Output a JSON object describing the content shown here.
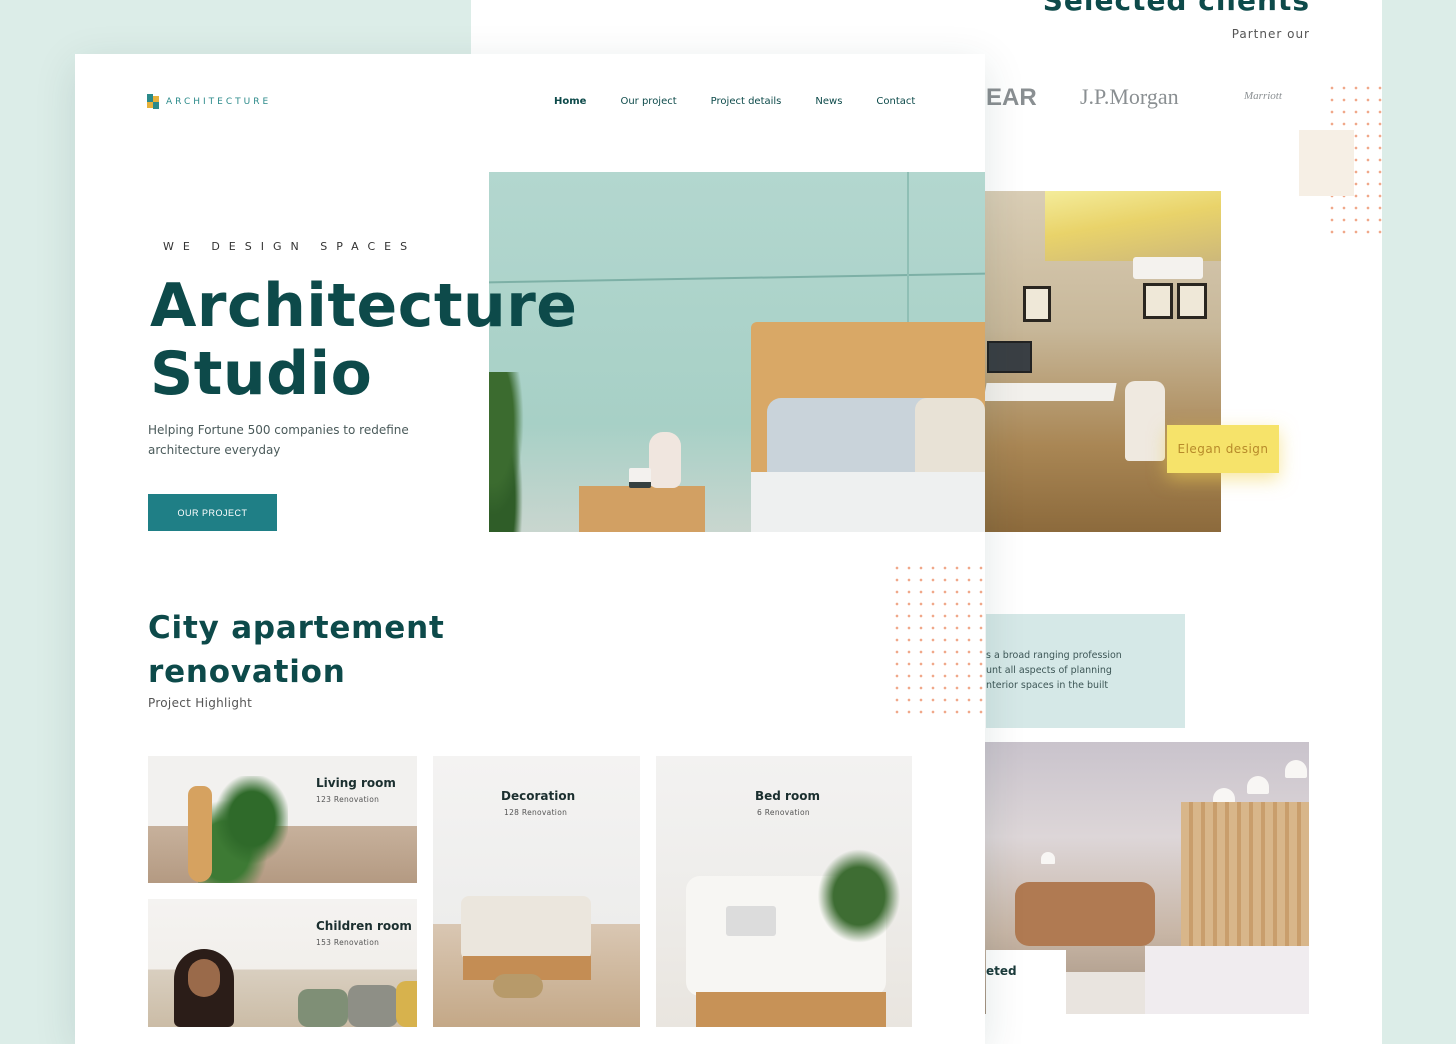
{
  "back_page": {
    "title": "Selected clients",
    "subtitle": "Partner our",
    "logos": [
      "EAR",
      "J.P.Morgan",
      "Marriott"
    ],
    "badge": "Elegan design",
    "about_lines": [
      "s a broad ranging profession",
      "unt all aspects of planning",
      "nterior spaces in the built"
    ],
    "completed_label": "eted"
  },
  "front_page": {
    "brand": "ARCHITECTURE",
    "nav": [
      {
        "label": "Home",
        "active": true
      },
      {
        "label": "Our project",
        "active": false
      },
      {
        "label": "Project details",
        "active": false
      },
      {
        "label": "News",
        "active": false
      },
      {
        "label": "Contact",
        "active": false
      }
    ],
    "hero": {
      "eyebrow": "WE DESIGN SPACES",
      "title_line1": "Architecture",
      "title_line2": "Studio",
      "subtitle": "Helping Fortune 500 companies to redefine architecture everyday",
      "button": "OUR PROJECT"
    },
    "section": {
      "title_line1": "City apartement",
      "title_line2": "renovation",
      "subtitle": "Project Highlight"
    },
    "cards": [
      {
        "title": "Living room",
        "sub": "123 Renovation"
      },
      {
        "title": "Decoration",
        "sub": "128 Renovation"
      },
      {
        "title": "Bed room",
        "sub": "6 Renovation"
      },
      {
        "title": "Children room",
        "sub": "153 Renovation"
      }
    ]
  },
  "colors": {
    "background": "#dcede8",
    "primary": "#0d4a4a",
    "accent": "#1f7f86",
    "badge": "#f6e36a"
  }
}
